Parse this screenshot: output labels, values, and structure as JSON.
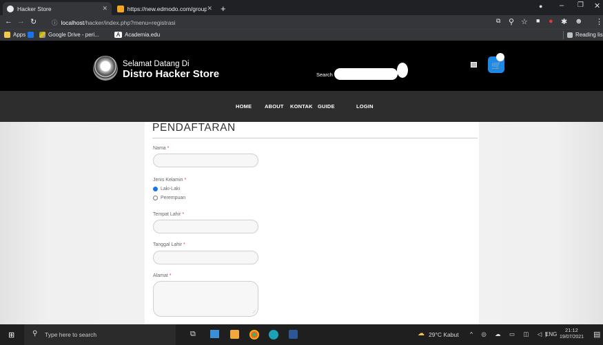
{
  "browser": {
    "tabs": [
      {
        "title": "Hacker Store",
        "active": true
      },
      {
        "title": "https://new.edmodo.com/group",
        "active": false
      }
    ],
    "new_tab": "+",
    "url_host": "localhost",
    "url_path": "/hacker/index.php?menu=registrasi",
    "bookmarks": [
      {
        "label": "Apps"
      },
      {
        "label": "Google Drive - peri..."
      },
      {
        "label": "Academia.edu"
      }
    ],
    "reading_list": "Reading lis"
  },
  "site": {
    "welcome": "Selamat Datang Di",
    "name": "Distro Hacker Store",
    "search_label": "Search",
    "nav": [
      "HOME",
      "ABOUT",
      "KONTAK",
      "GUIDE",
      "LOGIN"
    ]
  },
  "form": {
    "title": "PENDAFTARAN",
    "nama_label": "Nama",
    "jk_label": "Jenis Kelamin",
    "jk_options": [
      "Laki-Laki",
      "Perempuan"
    ],
    "tempat_label": "Tempat Lahir",
    "tanggal_label": "Tanggal Lahir",
    "alamat_label": "Alamat",
    "required_mark": "*"
  },
  "taskbar": {
    "search_placeholder": "Type here to search",
    "weather": "29°C Kabut",
    "lang": "ENG",
    "time": "21:12",
    "date": "19/07/2021"
  },
  "colors": {
    "accent_blue": "#1a73e8",
    "cart_blue": "#1e88e5"
  }
}
